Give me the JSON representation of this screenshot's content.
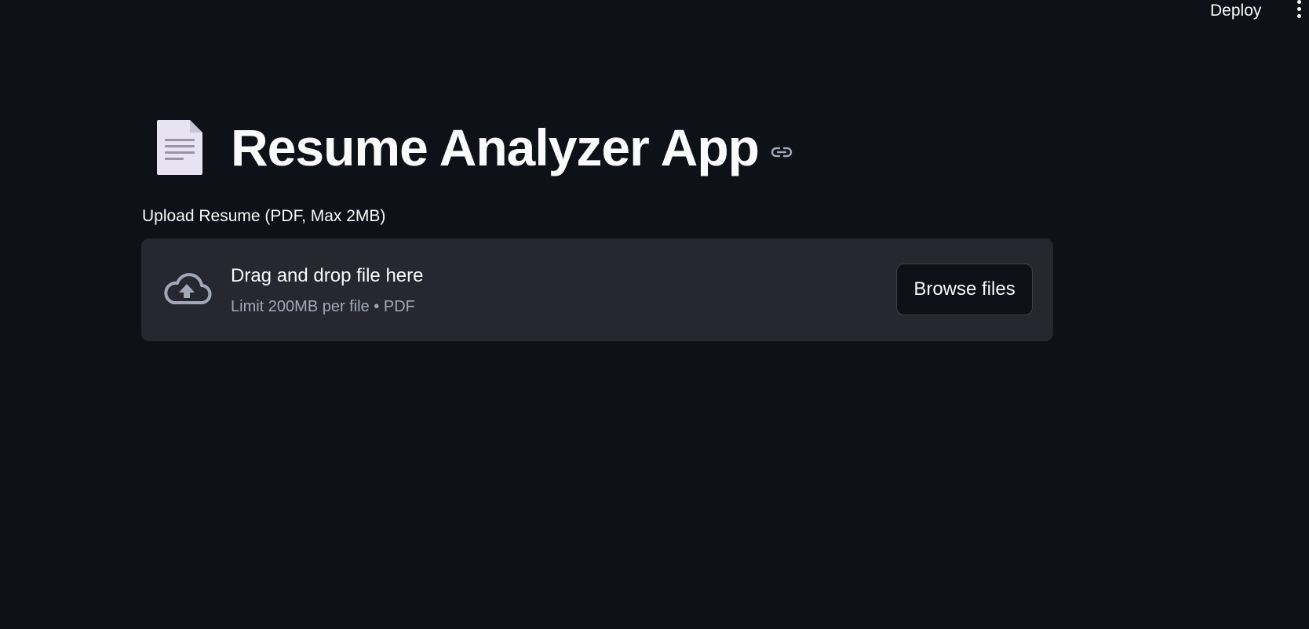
{
  "header": {
    "deploy_label": "Deploy",
    "menu_icon": "kebab-menu-icon"
  },
  "title": {
    "emoji_icon": "page-facing-up-icon",
    "text": "Resume Analyzer App",
    "anchor_icon": "link-icon"
  },
  "uploader": {
    "label": "Upload Resume (PDF, Max 2MB)",
    "dropzone_icon": "cloud-upload-icon",
    "instructions": "Drag and drop file here",
    "limits": "Limit 200MB per file • PDF",
    "browse_label": "Browse files"
  },
  "colors": {
    "background": "#0e1117",
    "dropzone": "#262730",
    "text": "#fafafa",
    "muted_text": "#a3a8b8",
    "border": "#3d3f4a"
  }
}
